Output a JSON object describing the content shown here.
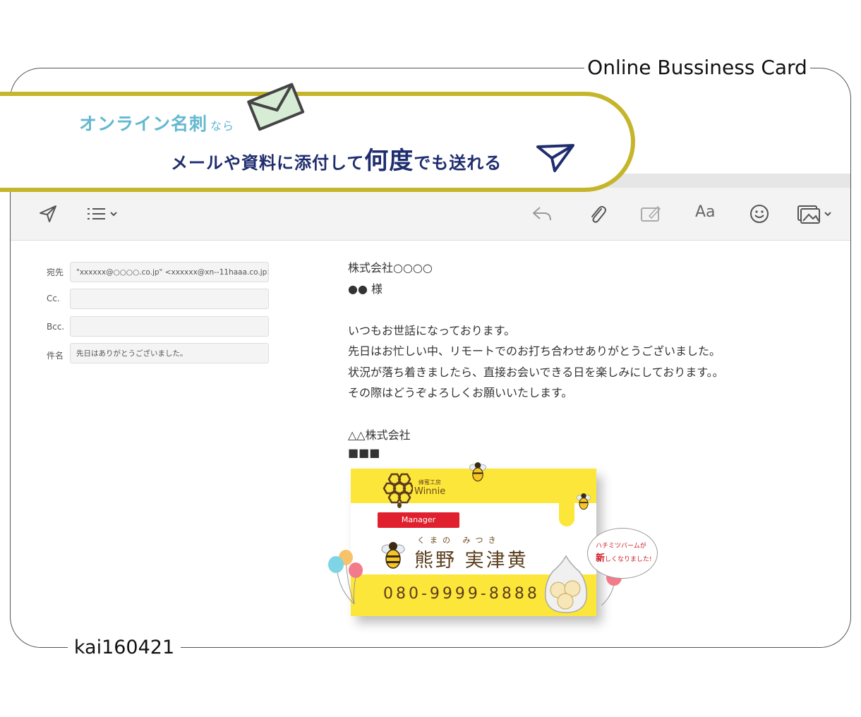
{
  "frame": {
    "title": "Online Bussiness Card",
    "footer": "kai160421"
  },
  "banner": {
    "line1_main": "オンライン名刺",
    "line1_small": "なら",
    "line2_a": "メールや資料に添付して",
    "line2_big": "何度",
    "line2_b": "でも送れる"
  },
  "toolbar": {
    "font_label": "Aa",
    "icons": [
      "send-icon",
      "list-icon",
      "reply-icon",
      "paperclip-icon",
      "markup-icon",
      "font-icon",
      "emoji-icon",
      "photo-icon"
    ]
  },
  "fields": {
    "to_label": "宛先",
    "to_value": "\"xxxxxx@○○○○.co.jp\" <xxxxxx@xn--11haaa.co.jp>",
    "cc_label": "Cc.",
    "cc_value": "",
    "bcc_label": "Bcc.",
    "bcc_value": "",
    "subject_label": "件名",
    "subject_value": "先日はありがとうございました。"
  },
  "body": {
    "company": "株式会社○○○○",
    "recipient": "●● 様",
    "p1": "いつもお世話になっております。",
    "p2": "先日はお忙しい中、リモートでのお打ち合わせありがとうございました。",
    "p3": "状況が落ち着きましたら、直接お会いできる日を楽しみにしております。。",
    "p4": "その際はどうぞよろしくお願いいたします。",
    "sender_company": "△△株式会社",
    "sender_name": "■■■"
  },
  "card": {
    "logo_sub": "蜂蜜工房",
    "logo": "Winnie",
    "role": "Manager",
    "furigana": "くまの みつき",
    "name": "熊野 実津黄",
    "phone": "080-9999-8888",
    "bubble_line1": "ハチミツバームが",
    "bubble_big": "新",
    "bubble_line2": "しくなりました!"
  },
  "colors": {
    "banner_border": "#c5b52a",
    "banner_teal": "#63b8d0",
    "banner_navy": "#1f2d6e",
    "card_yellow": "#fde63a",
    "card_red": "#e0202e"
  }
}
